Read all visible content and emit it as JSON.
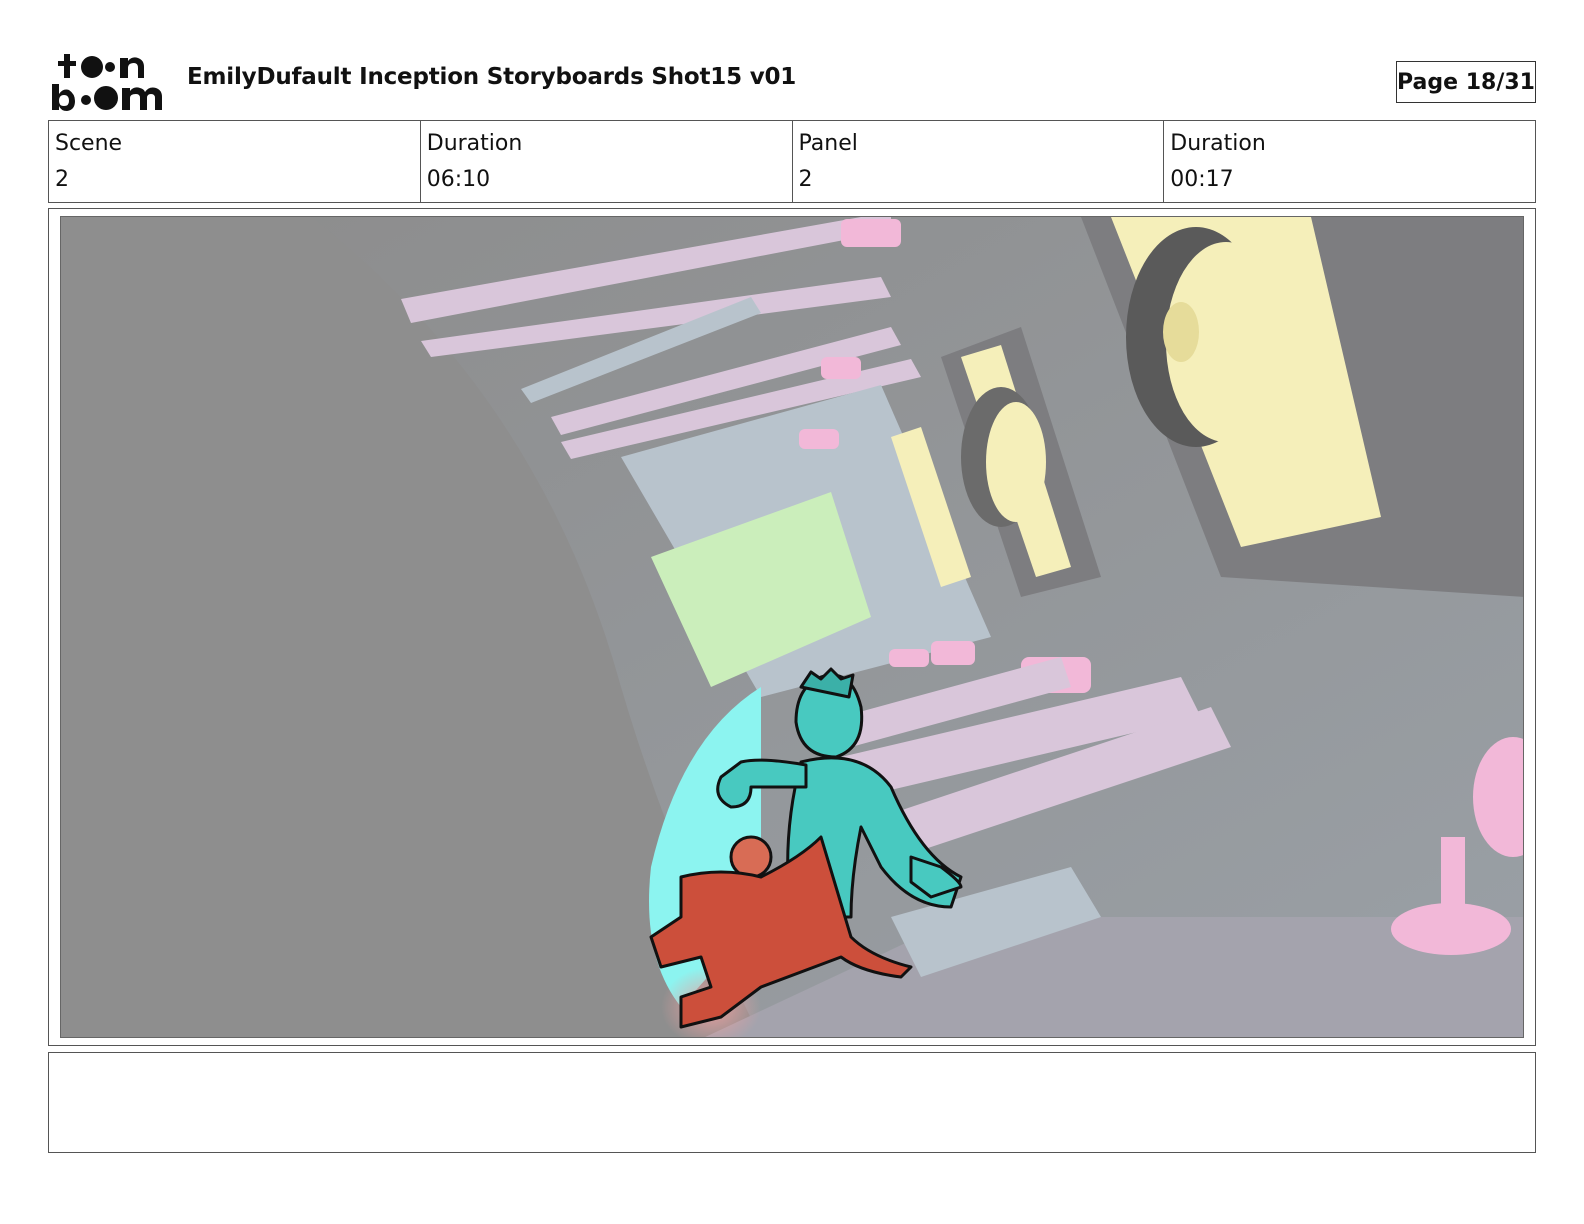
{
  "header": {
    "logo_text": "toon boom",
    "title": "EmilyDufault Inception Storyboards Shot15 v01",
    "page": "Page 18/31"
  },
  "info": {
    "scene_label": "Scene",
    "scene_value": "2",
    "scene_duration_label": "Duration",
    "scene_duration_value": "06:10",
    "panel_label": "Panel",
    "panel_value": "2",
    "panel_duration_label": "Duration",
    "panel_duration_value": "00:17"
  },
  "panel": {
    "image_name": "storyboard-panel-drawing"
  },
  "notes": {
    "text": ""
  },
  "colors": {
    "background_gray": "#8f8f8f",
    "wall_blue": "#b8c3cc",
    "pink": "#f2b8d8",
    "yellow": "#f5efba",
    "green": "#cbeebb",
    "cyan_character": "#48c9c0",
    "red_character": "#cc4f3b"
  }
}
